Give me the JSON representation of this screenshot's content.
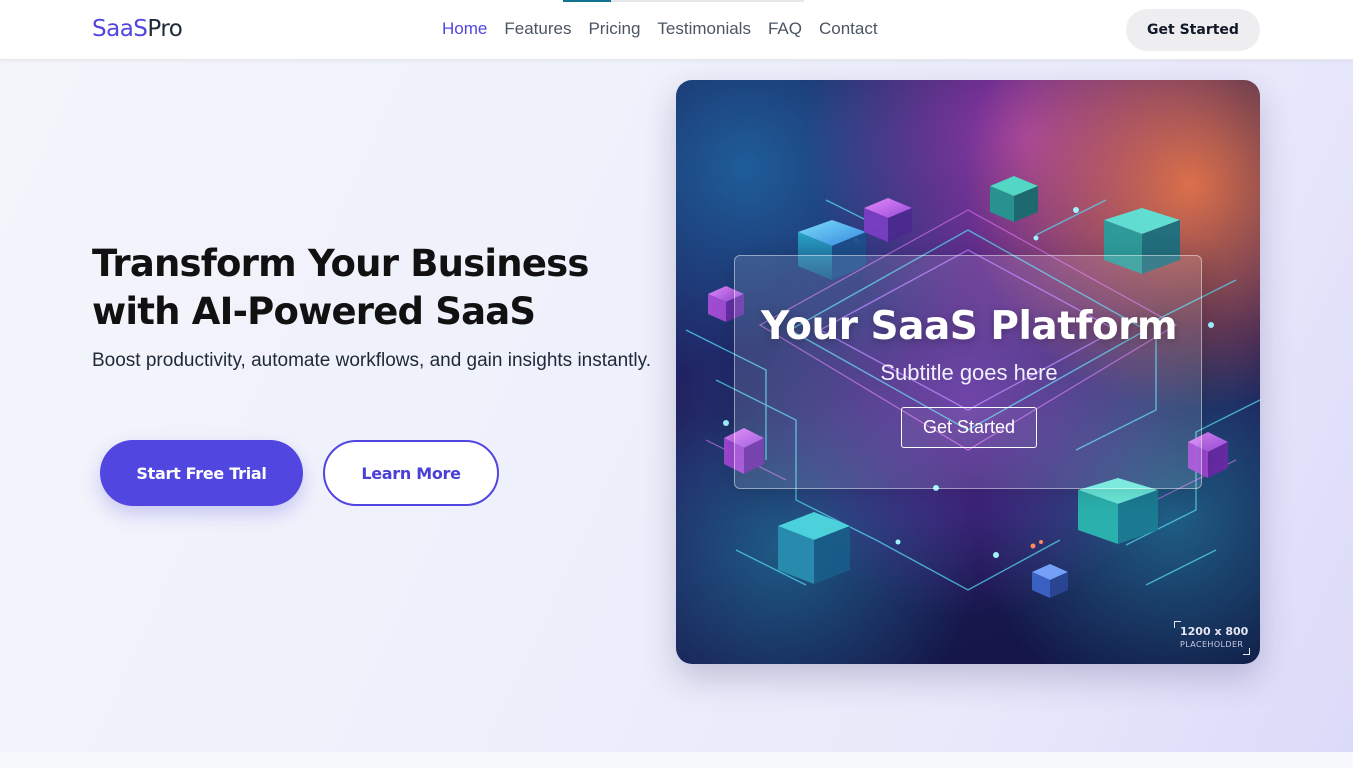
{
  "navbar": {
    "logo_part1": "SaaS",
    "logo_part2": "Pro",
    "links": [
      {
        "label": "Home"
      },
      {
        "label": "Features"
      },
      {
        "label": "Pricing"
      },
      {
        "label": "Testimonials"
      },
      {
        "label": "FAQ"
      },
      {
        "label": "Contact"
      }
    ],
    "cta_label": "Get Started"
  },
  "hero": {
    "headline": "Transform Your Business with AI-Powered SaaS",
    "subtext": "Boost productivity, automate workflows, and gain insights instantly.",
    "primary_button": "Start Free Trial",
    "secondary_button": "Learn More"
  },
  "hero_image": {
    "title": "Your SaaS Platform",
    "subtitle": "Subtitle goes here",
    "button_label": "Get Started",
    "placeholder_dims": "1200 x 800",
    "placeholder_label": "PLACEHOLDER"
  },
  "colors": {
    "brand": "#5146e0",
    "text_dark": "#111827",
    "nav_text": "#4b5563"
  }
}
